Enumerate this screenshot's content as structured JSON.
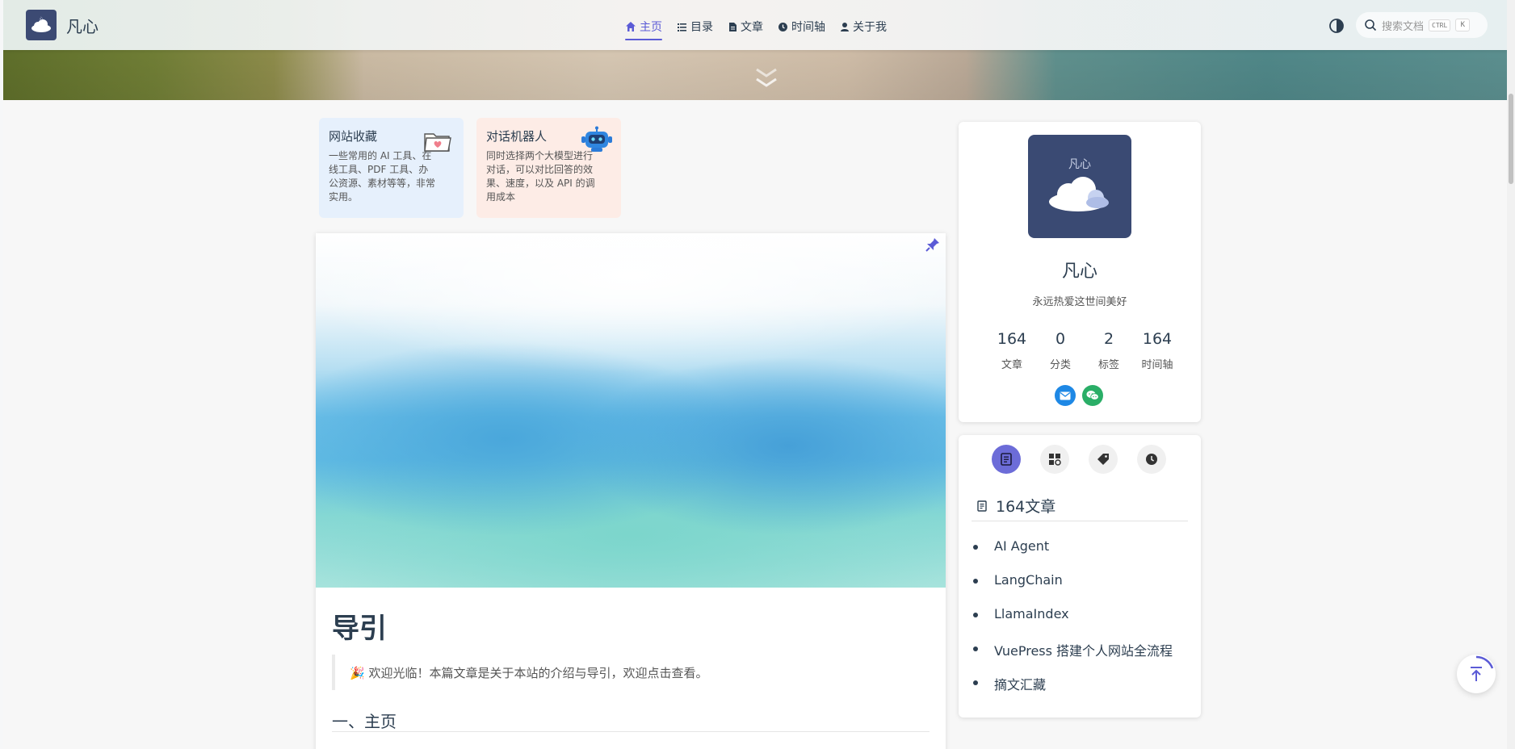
{
  "site": {
    "name": "凡心"
  },
  "nav": {
    "links": [
      {
        "label": "主页",
        "active": true
      },
      {
        "label": "目录"
      },
      {
        "label": "文章"
      },
      {
        "label": "时间轴"
      },
      {
        "label": "关于我"
      }
    ]
  },
  "search": {
    "placeholder": "搜索文档",
    "key1": "CTRL",
    "key2": "K"
  },
  "features": [
    {
      "title": "网站收藏",
      "desc": "一些常用的 AI 工具、在线工具、PDF 工具、办公资源、素材等等，非常实用。",
      "bg": "#e6f0fc"
    },
    {
      "title": "对话机器人",
      "desc": "同时选择两个大模型进行对话，可以对比回答的效果、速度，以及 API 的调用成本",
      "bg": "#fdece6"
    }
  ],
  "article": {
    "title": "导引",
    "notice": "🎉 欢迎光临！本篇文章是关于本站的介绍与导引，欢迎点击查看。",
    "section1": "一、主页"
  },
  "profile": {
    "avatar_caption": "凡心",
    "name": "凡心",
    "motto": "永远热爱这世间美好",
    "stats": [
      {
        "value": "164",
        "label": "文章"
      },
      {
        "value": "0",
        "label": "分类"
      },
      {
        "value": "2",
        "label": "标签"
      },
      {
        "value": "164",
        "label": "时间轴"
      }
    ]
  },
  "articles_panel": {
    "heading": "164文章",
    "items": [
      "AI Agent",
      "LangChain",
      "LlamaIndex",
      "VuePress 搭建个人网站全流程",
      "摘文汇藏"
    ]
  },
  "colors": {
    "accent": "#5b5bd6",
    "avatar_bg": "#3a4a73",
    "email": "#1e88e5",
    "wechat": "#2aae67"
  }
}
